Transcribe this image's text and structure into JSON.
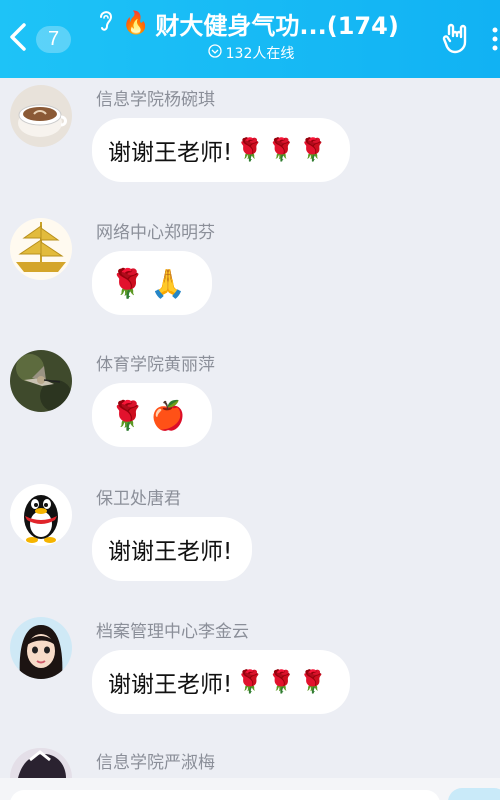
{
  "header": {
    "unread_count": "7",
    "fire_icon": "🔥",
    "title": "财大健身气功...(174)",
    "online_text": "132人在线",
    "brand_color": "#12b7f5"
  },
  "messages": [
    {
      "sender": "信息学院杨碗琪",
      "text": "谢谢王老师!",
      "emoji": "🌹🌹🌹",
      "avatar": "coffee-cup"
    },
    {
      "sender": "网络中心郑明芬",
      "text": "",
      "emoji": "🌹🙏",
      "avatar": "golden-ship"
    },
    {
      "sender": "体育学院黄丽萍",
      "text": "",
      "emoji": "🌹🍎",
      "avatar": "hummingbird"
    },
    {
      "sender": "保卫处唐君",
      "text": "谢谢王老师!",
      "emoji": "",
      "avatar": "qq-penguin"
    },
    {
      "sender": "档案管理中心李金云",
      "text": "谢谢王老师!",
      "emoji": "🌹🌹🌹",
      "avatar": "cartoon-girl"
    },
    {
      "sender": "信息学院严淑梅",
      "text": "",
      "emoji": "",
      "avatar": "partial"
    }
  ]
}
